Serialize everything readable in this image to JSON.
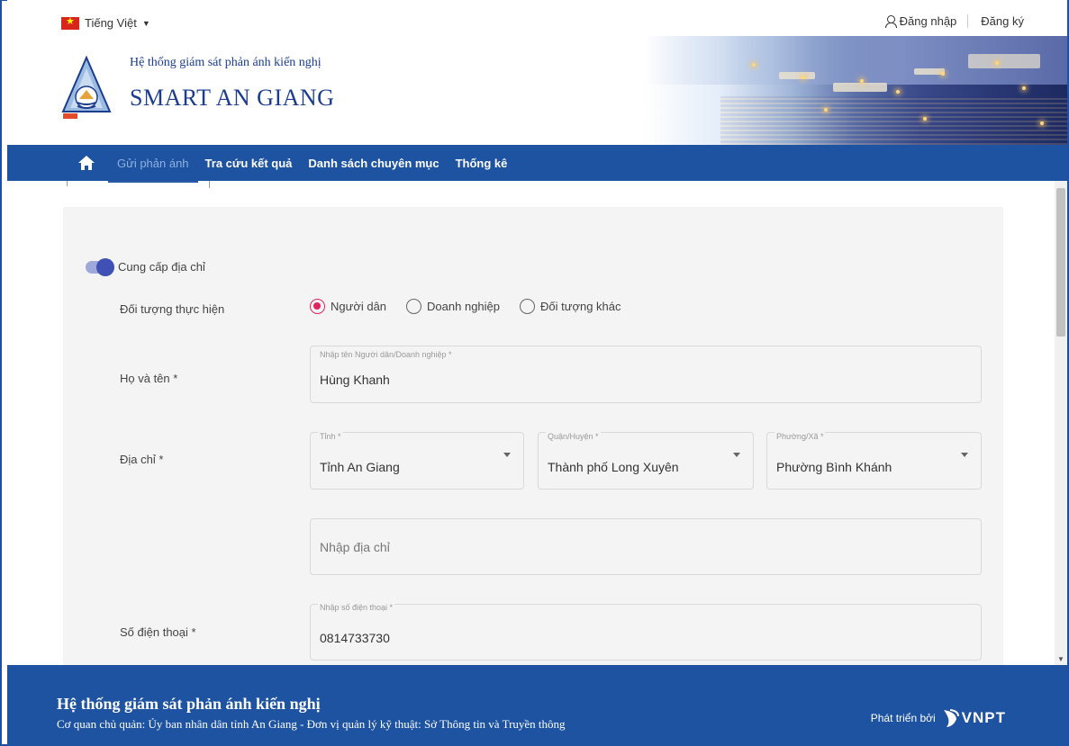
{
  "header": {
    "language": "Tiếng Việt",
    "login": "Đăng nhập",
    "register": "Đăng ký",
    "system_subtitle": "Hệ thống giám sát phản ánh kiến nghị",
    "system_title": "SMART AN GIANG"
  },
  "nav": {
    "items": [
      "Gửi phản ánh",
      "Tra cứu kết quả",
      "Danh sách chuyên mục",
      "Thống kê"
    ]
  },
  "form": {
    "toggle_label": "Cung cấp địa chỉ",
    "subject_label": "Đối tượng thực hiện",
    "subject_options": [
      "Người dân",
      "Doanh nghiệp",
      "Đối tượng khác"
    ],
    "subject_selected": "Người dân",
    "name_label": "Họ và tên *",
    "name_floating": "Nhập tên Người dân/Doanh nghiệp *",
    "name_value": "Hùng Khanh",
    "address_label": "Địa chỉ *",
    "province_floating": "Tỉnh *",
    "province_value": "Tỉnh An Giang",
    "district_floating": "Quận/Huyện *",
    "district_value": "Thành phố Long Xuyên",
    "ward_floating": "Phường/Xã *",
    "ward_value": "Phường Bình Khánh",
    "street_placeholder": "Nhập địa chỉ",
    "phone_label": "Số điện thoại *",
    "phone_floating": "Nhập số điện thoại *",
    "phone_value": "0814733730"
  },
  "footer": {
    "title": "Hệ thống giám sát phản ánh kiến nghị",
    "subtitle": "Cơ quan chủ quản: Ủy ban nhân dân tỉnh An Giang - Đơn vị quản lý kỹ thuật: Sở Thông tin và Truyền thông",
    "developed_by": "Phát triển bởi",
    "vendor": "VNPT"
  },
  "colors": {
    "brand_blue": "#1d53a0",
    "title_blue": "#1a3d8f",
    "radio_selected": "#e0245e",
    "toggle": "#3f51b5"
  }
}
